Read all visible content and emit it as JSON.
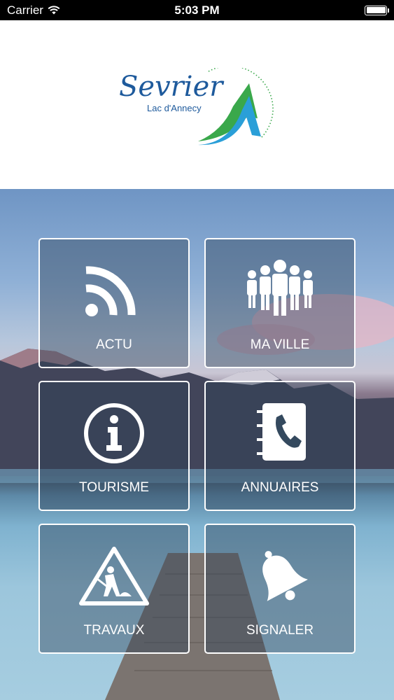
{
  "status_bar": {
    "carrier": "Carrier",
    "time": "5:03 PM",
    "wifi_icon": "wifi-icon",
    "battery_icon": "battery-icon",
    "battery_level": 1.0
  },
  "logo": {
    "brand": "Sevrier",
    "tagline": "Lac d'Annecy",
    "colors": {
      "text": "#1e5a9c",
      "green": "#3aa84b",
      "blue": "#2a9fd8"
    }
  },
  "tiles": [
    {
      "label": "ACTU",
      "icon": "rss-icon"
    },
    {
      "label": "MA VILLE",
      "icon": "people-icon"
    },
    {
      "label": "TOURISME",
      "icon": "info-icon"
    },
    {
      "label": "ANNUAIRES",
      "icon": "phonebook-icon"
    },
    {
      "label": "TRAVAUX",
      "icon": "roadwork-icon"
    },
    {
      "label": "SIGNALER",
      "icon": "bell-icon"
    }
  ]
}
